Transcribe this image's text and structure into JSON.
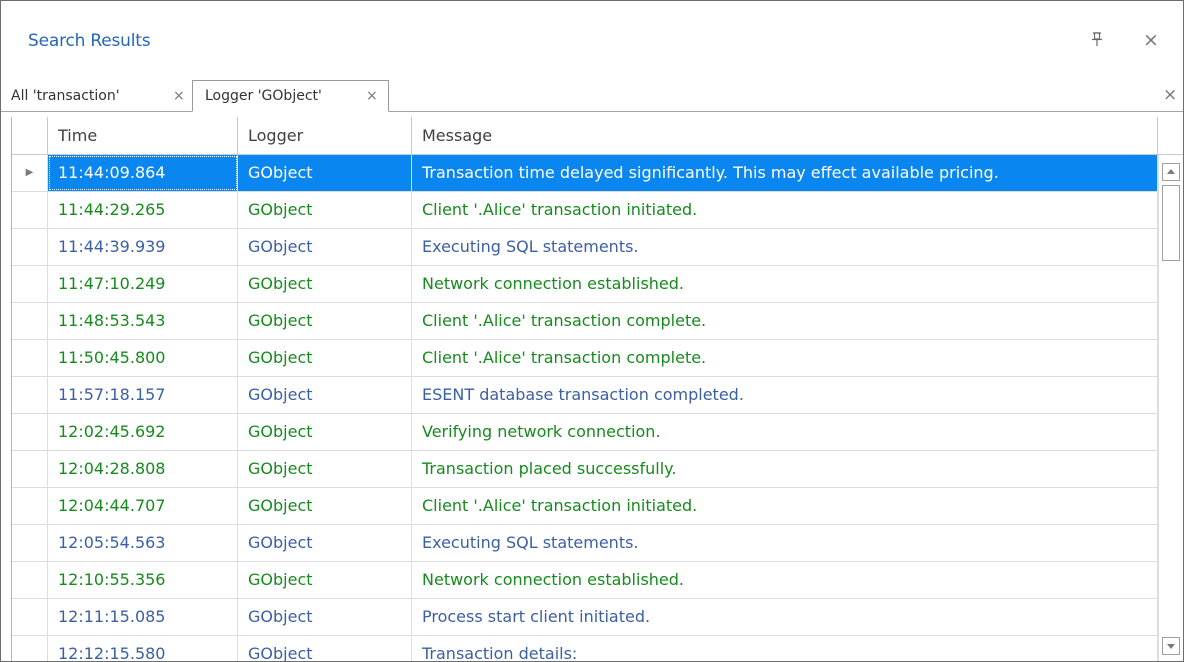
{
  "panel": {
    "title": "Search Results"
  },
  "icons": {
    "pin": "pin-icon",
    "close": "close-icon",
    "row_indicator": "triangle-right-icon"
  },
  "colors": {
    "accent": "#2566b6",
    "selection": "#0a86f0",
    "green_text": "#178a1e",
    "blue_text": "#3b5fa3"
  },
  "tabs": [
    {
      "label": "All 'transaction'",
      "active": false
    },
    {
      "label": "Logger 'GObject'",
      "active": true
    }
  ],
  "grid": {
    "headers": {
      "time": "Time",
      "logger": "Logger",
      "message": "Message"
    },
    "rows": [
      {
        "time": "11:44:09.864",
        "logger": "GObject",
        "message": "Transaction time delayed significantly.  This may effect available pricing.",
        "tone": "selected"
      },
      {
        "time": "11:44:29.265",
        "logger": "GObject",
        "message": "Client '.Alice' transaction initiated.",
        "tone": "green"
      },
      {
        "time": "11:44:39.939",
        "logger": "GObject",
        "message": "Executing SQL statements.",
        "tone": "blue"
      },
      {
        "time": "11:47:10.249",
        "logger": "GObject",
        "message": "Network connection established.",
        "tone": "green"
      },
      {
        "time": "11:48:53.543",
        "logger": "GObject",
        "message": "Client '.Alice' transaction complete.",
        "tone": "green"
      },
      {
        "time": "11:50:45.800",
        "logger": "GObject",
        "message": "Client '.Alice' transaction complete.",
        "tone": "green"
      },
      {
        "time": "11:57:18.157",
        "logger": "GObject",
        "message": "ESENT database transaction completed.",
        "tone": "blue"
      },
      {
        "time": "12:02:45.692",
        "logger": "GObject",
        "message": "Verifying network connection.",
        "tone": "green"
      },
      {
        "time": "12:04:28.808",
        "logger": "GObject",
        "message": "Transaction placed successfully.",
        "tone": "green"
      },
      {
        "time": "12:04:44.707",
        "logger": "GObject",
        "message": "Client '.Alice' transaction initiated.",
        "tone": "green"
      },
      {
        "time": "12:05:54.563",
        "logger": "GObject",
        "message": "Executing SQL statements.",
        "tone": "blue"
      },
      {
        "time": "12:10:55.356",
        "logger": "GObject",
        "message": "Network connection established.",
        "tone": "green"
      },
      {
        "time": "12:11:15.085",
        "logger": "GObject",
        "message": "Process start client initiated.",
        "tone": "blue"
      },
      {
        "time": "12:12:15.580",
        "logger": "GObject",
        "message": "Transaction details:",
        "tone": "blue"
      }
    ]
  }
}
